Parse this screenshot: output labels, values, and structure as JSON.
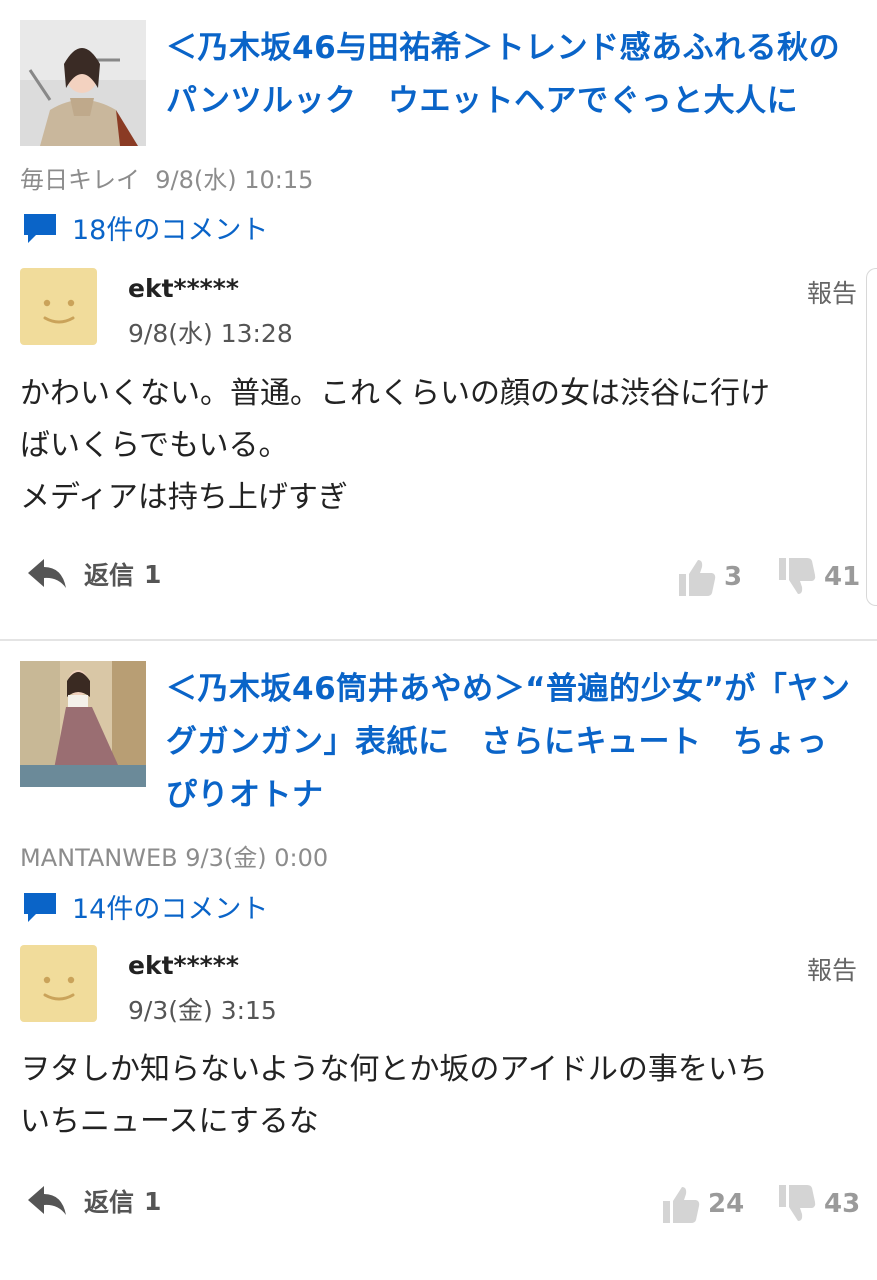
{
  "articles": [
    {
      "title_lines": [
        "＜乃木坂46与田祐希＞トレンド感あふれる秋の",
        "パンツルック　ウエットヘアでぐっと大人に"
      ],
      "source": "毎日キレイ",
      "datetime": "9/8(水) 10:15",
      "comment_count_label": "18件のコメント",
      "comment": {
        "user": "ekt*****",
        "time": "9/8(水) 13:28",
        "report_label": "報告",
        "text_lines": [
          "かわいくない。普通。これくらいの顔の女は渋谷に行け",
          "ばいくらでもいる。",
          "メディアは持ち上げすぎ"
        ],
        "reply_label": "返信",
        "reply_count": "1",
        "likes": "3",
        "dislikes": "41"
      }
    },
    {
      "title_lines": [
        "＜乃木坂46筒井あやめ＞“普遍的少女”が「ヤン",
        "グガンガン」表紙に　さらにキュート　ちょっ",
        "ぴりオトナ"
      ],
      "source": "MANTANWEB",
      "datetime": "9/3(金) 0:00",
      "comment_count_label": "14件のコメント",
      "comment": {
        "user": "ekt*****",
        "time": "9/3(金) 3:15",
        "report_label": "報告",
        "text_lines": [
          "ヲタしか知らないような何とか坂のアイドルの事をいち",
          "いちニュースにするな"
        ],
        "reply_label": "返信",
        "reply_count": "1",
        "likes": "24",
        "dislikes": "43"
      }
    }
  ],
  "colors": {
    "link_blue": "#0a64c8",
    "avatar_bg": "#f1dc9b",
    "meta_gray": "#8c8c8c"
  },
  "icons": [
    "comment-bubble-icon",
    "reply-arrow-icon",
    "thumbs-up-icon",
    "thumbs-down-icon",
    "smiley-face-icon"
  ]
}
